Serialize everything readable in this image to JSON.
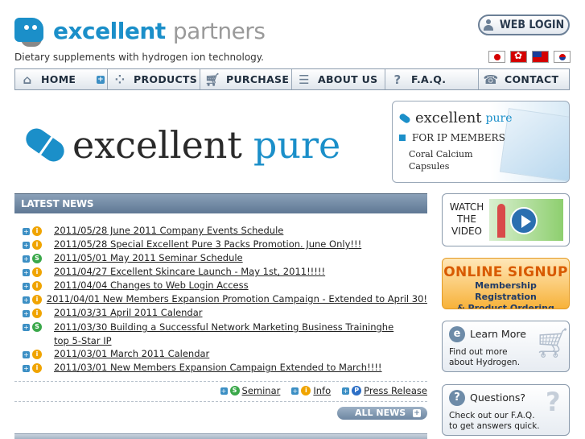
{
  "header": {
    "logo_primary": "excellent",
    "logo_secondary": "partners",
    "tagline": "Dietary supplements with hydrogen ion technology.",
    "web_login_label": "WEB LOGIN",
    "flags": [
      "japan-flag-icon",
      "hong-kong-flag-icon",
      "taiwan-flag-icon",
      "korea-flag-icon"
    ]
  },
  "nav": {
    "items": [
      {
        "label": "HOME",
        "icon": "home-icon"
      },
      {
        "label": "PRODUCTS",
        "icon": "products-icon"
      },
      {
        "label": "PURCHASE",
        "icon": "cart-icon"
      },
      {
        "label": "ABOUT US",
        "icon": "document-icon"
      },
      {
        "label": "F.A.Q.",
        "icon": "question-icon"
      },
      {
        "label": "CONTACT",
        "icon": "phone-icon"
      }
    ]
  },
  "banner": {
    "word1": "excellent",
    "word2": "pure"
  },
  "ip_box": {
    "brand1": "excellent",
    "brand2": "pure",
    "members": "FOR IP MEMBERS",
    "line1": "Coral Calcium",
    "line2": "Capsules"
  },
  "news": {
    "heading": "LATEST NEWS",
    "items": [
      {
        "cat": "i",
        "text": "2011/05/28  June 2011 Company Events Schedule"
      },
      {
        "cat": "i",
        "text": "2011/05/28  Special Excellent Pure 3 Packs Promotion. June Only!!!"
      },
      {
        "cat": "s",
        "text": "2011/05/01  May 2011 Seminar Schedule"
      },
      {
        "cat": "i",
        "text": "2011/04/27  Excellent Skincare Launch - May 1st, 2011!!!!!"
      },
      {
        "cat": "i",
        "text": "2011/04/04  Changes to Web Login Access"
      },
      {
        "cat": "i",
        "text": "2011/04/01  New Members Expansion Promotion Campaign - Extended to April 30!"
      },
      {
        "cat": "i",
        "text": "2011/03/31  April 2011 Calendar"
      },
      {
        "cat": "s",
        "text": "2011/03/30  Building a Successful Network Marketing Business Traininghe top 5-Star IP"
      },
      {
        "cat": "i",
        "text": "2011/03/01  March 2011 Calendar"
      },
      {
        "cat": "i",
        "text": "2011/03/01  New Members Expansion Campaign Extended to March!!!!"
      }
    ],
    "legend": {
      "seminar": "Seminar",
      "info": "Info",
      "press": "Press Release"
    },
    "all_news": "ALL NEWS"
  },
  "side": {
    "video_label": "WATCH THE VIDEO",
    "signup_title": "ONLINE SIGNUP",
    "signup_line1": "Membership Registration",
    "signup_line2": "& Product Ordering",
    "learn_title": "Learn More",
    "learn_line1": "Find out more",
    "learn_line2": "about Hydrogen.",
    "faq_title": "Questions?",
    "faq_line1": "Check out our F.A.Q.",
    "faq_line2": "to get answers quick."
  },
  "colors": {
    "brand_blue": "#1b8fc9",
    "nav_text": "#1f2d3d",
    "signup_orange": "#d85a00"
  }
}
